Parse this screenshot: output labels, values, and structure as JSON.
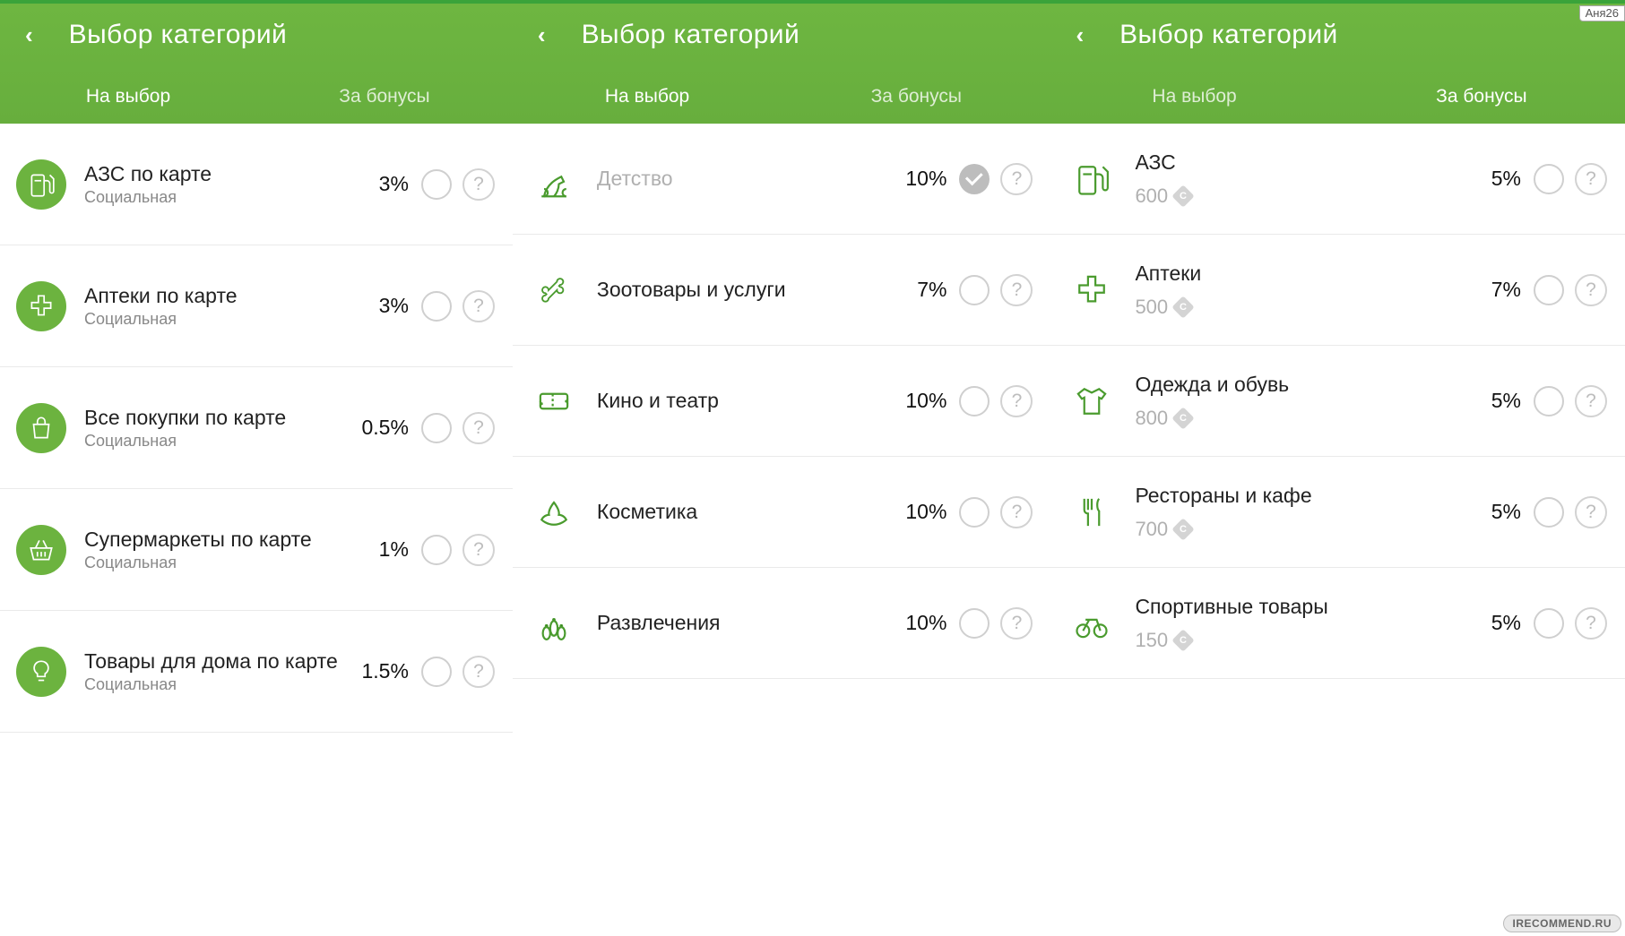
{
  "user_badge": "Аня26",
  "watermark": "IRECOMMEND.RU",
  "headers": {
    "title": "Выбор категорий",
    "tab_choice": "На выбор",
    "tab_bonus": "За бонусы"
  },
  "panel1": {
    "rows": [
      {
        "icon": "fuel",
        "name": "АЗС по карте",
        "sub": "Социальная",
        "pct": "3%"
      },
      {
        "icon": "cross",
        "name": "Аптеки по карте",
        "sub": "Социальная",
        "pct": "3%"
      },
      {
        "icon": "bag",
        "name": "Все покупки по карте",
        "sub": "Социальная",
        "pct": "0.5%"
      },
      {
        "icon": "basket",
        "name": "Супермаркеты по карте",
        "sub": "Социальная",
        "pct": "1%"
      },
      {
        "icon": "lamp",
        "name": "Товары для дома по карте",
        "sub": "Социальная",
        "pct": "1.5%"
      }
    ]
  },
  "panel2": {
    "rows": [
      {
        "icon": "horse",
        "name": "Детство",
        "pct": "10%",
        "muted": true,
        "checked": true
      },
      {
        "icon": "bone",
        "name": "Зоотовары и услуги",
        "pct": "7%"
      },
      {
        "icon": "tickets",
        "name": "Кино и театр",
        "pct": "10%"
      },
      {
        "icon": "lotus",
        "name": "Косметика",
        "pct": "10%"
      },
      {
        "icon": "bowling",
        "name": "Развлечения",
        "pct": "10%"
      }
    ]
  },
  "panel3": {
    "rows": [
      {
        "icon": "fuel",
        "name": "АЗС",
        "price": "600",
        "pct": "5%"
      },
      {
        "icon": "cross",
        "name": "Аптеки",
        "price": "500",
        "pct": "7%"
      },
      {
        "icon": "shirt",
        "name": "Одежда и обувь",
        "price": "800",
        "pct": "5%"
      },
      {
        "icon": "cutlery",
        "name": "Рестораны и кафе",
        "price": "700",
        "pct": "5%"
      },
      {
        "icon": "bike",
        "name": "Спортивные товары",
        "price": "150",
        "pct": "5%"
      }
    ]
  }
}
